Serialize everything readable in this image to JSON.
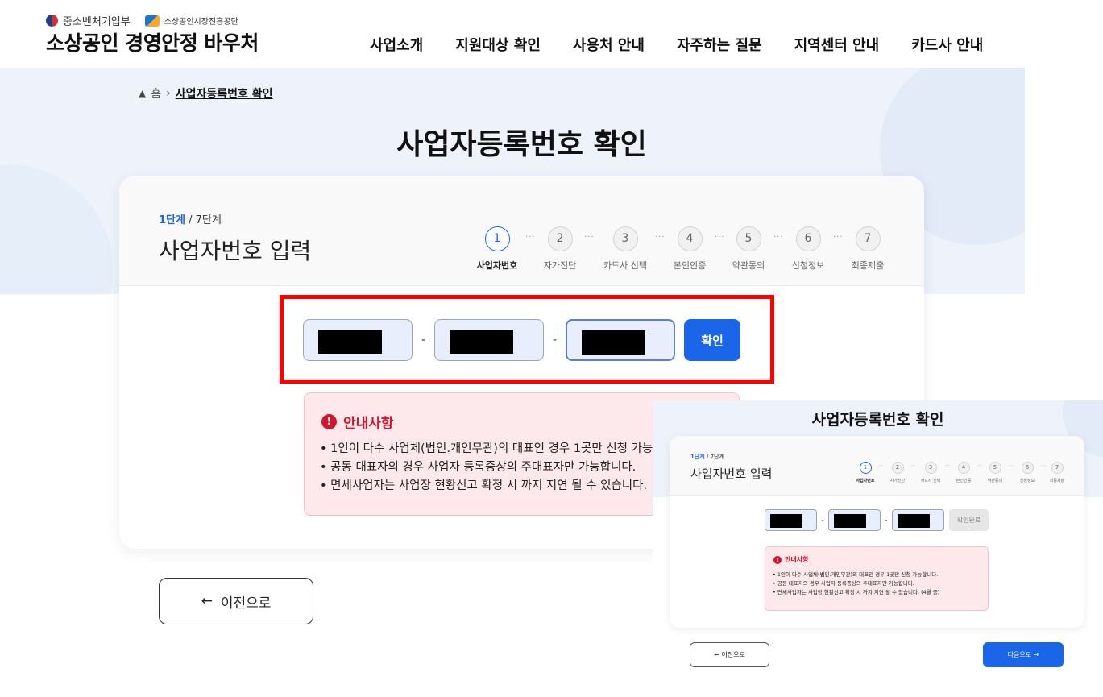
{
  "header": {
    "ministry": "중소벤처기업부",
    "agency": "소상공인시장진흥공단",
    "brand": "소상공인 경영안정 바우처",
    "nav": [
      "사업소개",
      "지원대상 확인",
      "사용처 안내",
      "자주하는 질문",
      "지역센터 안내",
      "카드사 안내"
    ]
  },
  "breadcrumb": {
    "home": "홈",
    "separator": "›",
    "current": "사업자등록번호 확인"
  },
  "page": {
    "title": "사업자등록번호 확인"
  },
  "step": {
    "current": "1단계",
    "total": "/ 7단계",
    "title": "사업자번호 입력"
  },
  "steps": [
    {
      "num": "1",
      "label": "사업자번호",
      "active": true
    },
    {
      "num": "2",
      "label": "자가진단"
    },
    {
      "num": "3",
      "label": "카드사 선택"
    },
    {
      "num": "4",
      "label": "본인인증"
    },
    {
      "num": "5",
      "label": "약관동의"
    },
    {
      "num": "6",
      "label": "신청정보"
    },
    {
      "num": "7",
      "label": "최종제출"
    }
  ],
  "step_dots": "···",
  "business_number": {
    "separator": "-",
    "confirm_label": "확인",
    "masked": true
  },
  "notice": {
    "title": "안내사항",
    "items": [
      "• 1인이 다수 사업체(법인.개인무관)의 대표인 경우 1곳만 신청 가능합니다.",
      "• 공동 대표자의 경우 사업자 등록증상의 주대표자만 가능합니다.",
      "• 면세사업자는 사업장 현황신고 확정 시 까지 지연 될 수 있습니다."
    ]
  },
  "prev_button": {
    "arrow": "←",
    "label": "이전으로"
  },
  "inset": {
    "title": "사업자등록번호 확인",
    "step_current": "1단계",
    "step_total": "/ 7단계",
    "step_title": "사업자번호 입력",
    "done_label": "확인완료",
    "notice_title": "안내사항",
    "notice_items": [
      "• 1인이 다수 사업체(법인.개인무관)의 대표인 경우 1곳만 신청 가능합니다.",
      "• 공동 대표자의 경우 사업자 등록증상의 주대표자만 가능합니다.",
      "• 면세사업자는 사업장 현황신고 확정 시 까지 지연 될 수 있습니다. (4월 중)"
    ],
    "prev_label": "← 이전으로",
    "next_label": "다음으로 →"
  },
  "colors": {
    "accent": "#1b66e8",
    "alert": "#d0152d",
    "notice_bg": "#fde8ec",
    "highlight": "#ff0000",
    "hero_bg": "#eef3fb"
  }
}
